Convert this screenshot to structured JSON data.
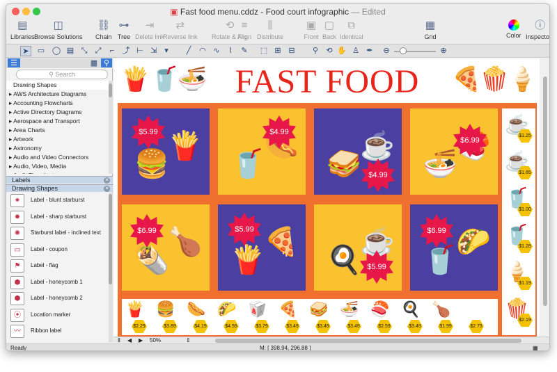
{
  "window": {
    "filename": "Fast food menu.cddz",
    "subtitle": " - Food court infographic",
    "edited": "— Edited"
  },
  "toolbar": [
    {
      "label": "Libraries",
      "icon": "libraries-icon",
      "glyph": "▤",
      "dis": false
    },
    {
      "label": "Browse Solutions",
      "icon": "browse-solutions-icon",
      "glyph": "◫",
      "dis": false
    },
    {
      "label": "Chain",
      "icon": "chain-icon",
      "glyph": "⛓",
      "dis": false
    },
    {
      "label": "Tree",
      "icon": "tree-icon",
      "glyph": "⊶",
      "dis": false
    },
    {
      "label": "Delete link",
      "icon": "delete-link-icon",
      "glyph": "⇥",
      "dis": true
    },
    {
      "label": "Reverse link",
      "icon": "reverse-link-icon",
      "glyph": "⇄",
      "dis": true
    },
    {
      "label": "Rotate & Flip",
      "icon": "rotate-flip-icon",
      "glyph": "⟲",
      "dis": true
    },
    {
      "label": "Align",
      "icon": "align-icon",
      "glyph": "≡",
      "dis": true
    },
    {
      "label": "Distribute",
      "icon": "distribute-icon",
      "glyph": "⫼",
      "dis": true
    },
    {
      "label": "Front",
      "icon": "front-icon",
      "glyph": "▣",
      "dis": true
    },
    {
      "label": "Back",
      "icon": "back-icon",
      "glyph": "▢",
      "dis": true
    },
    {
      "label": "Identical",
      "icon": "identical-icon",
      "glyph": "⧉",
      "dis": true
    },
    {
      "label": "Grid",
      "icon": "grid-icon",
      "glyph": "▦",
      "dis": false
    },
    {
      "label": "Color",
      "icon": "color-wheel-icon",
      "glyph": "●",
      "dis": false
    },
    {
      "label": "Inspectors",
      "icon": "inspectors-icon",
      "glyph": "ⓘ",
      "dis": false
    }
  ],
  "sidebar": {
    "search_placeholder": "Search",
    "libraries": [
      "Drawing Shapes",
      "AWS Architecture Diagrams",
      "Accounting Flowcharts",
      "Active Directory Diagrams",
      "Aerospace and Transport",
      "Area Charts",
      "Artwork",
      "Astronomy",
      "Audio and Video Connectors",
      "Audio, Video, Media",
      "Audit Flowcharts"
    ],
    "sections": [
      "Labels",
      "Drawing Shapes"
    ],
    "shapes": [
      "Label - blunt starburst",
      "Label - sharp starburst",
      "Starburst label - inclined text",
      "Label - coupon",
      "Label - flag",
      "Label - honeycomb 1",
      "Label - honeycomb 2",
      "Location marker",
      "Ribbon label"
    ]
  },
  "canvas": {
    "heading": "FAST FOOD",
    "tiles": [
      {
        "price": "$5.99",
        "items": [
          "🍔",
          "🍟"
        ]
      },
      {
        "price": "$4.99",
        "items": [
          "🥤",
          "🌭"
        ]
      },
      {
        "price": "$4.99",
        "items": [
          "🥪",
          "☕"
        ]
      },
      {
        "price": "$6.99",
        "items": [
          "🍜",
          "🍣"
        ]
      },
      {
        "price": "$6.99",
        "items": [
          "🌯",
          "🍗"
        ]
      },
      {
        "price": "$5.99",
        "items": [
          "🍟",
          "🍕"
        ]
      },
      {
        "price": "$5.99",
        "items": [
          "🍳",
          "☕"
        ]
      },
      {
        "price": "$6.99",
        "items": [
          "🥤",
          "🌮"
        ]
      }
    ],
    "side_prices": [
      "$1.25",
      "$1.65",
      "$1.00",
      "$1.28",
      "$1.19",
      "$2.19"
    ],
    "bottom_prices": [
      "$2.29",
      "$3.89",
      "$4.19",
      "$4.59",
      "$3.79",
      "$3.49",
      "$3.49",
      "$3.49",
      "$2.59",
      "$3.49",
      "$1.99",
      "$2.75"
    ]
  },
  "zoom": "50%",
  "coords": "M: [ 398.94, 296.88 ]",
  "status": "Ready"
}
